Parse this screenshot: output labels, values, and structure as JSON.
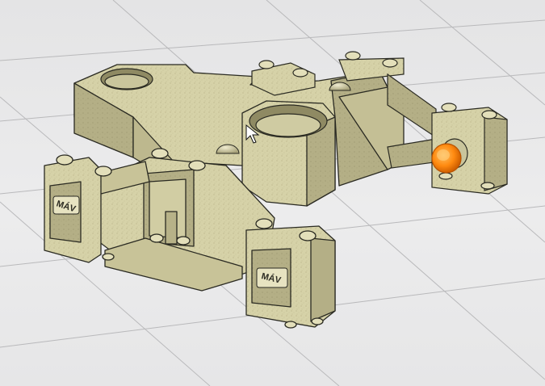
{
  "viewport": {
    "background": "#e9e9ea",
    "grid_color": "#b9b9bb",
    "part_color": "#d8d4aa",
    "part_shadow": "#a8a37a",
    "edge_color": "#2a2a22",
    "highlight_color": "#ff8a10",
    "cursor_icon": "arrow-cursor-icon"
  },
  "model": {
    "name": "",
    "plate_left_text": "MÁV",
    "plate_right_text": "MÁV"
  }
}
